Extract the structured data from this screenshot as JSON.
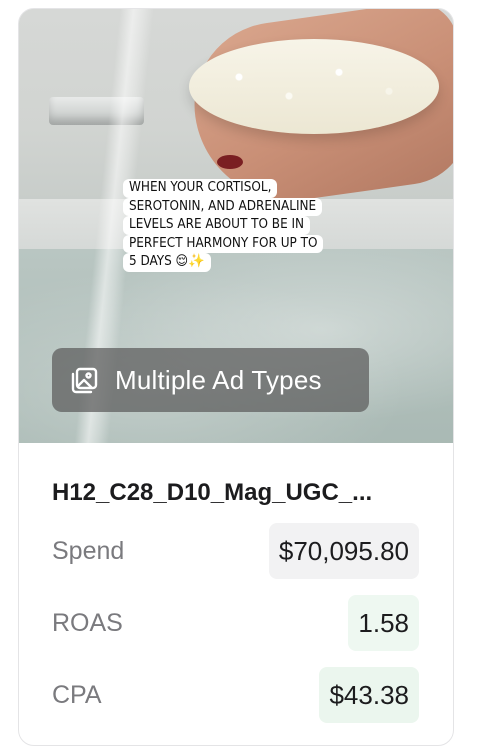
{
  "ad": {
    "caption_lines": [
      "WHEN YOUR CORTISOL,",
      "SEROTONIN, AND ADRENALINE",
      "LEVELS ARE ABOUT TO BE IN",
      "PERFECT HARMONY FOR UP TO",
      "5 DAYS 😌✨"
    ],
    "badge_label": "Multiple Ad Types",
    "badge_icon": "images-icon",
    "title": "H12_C28_D10_Mag_UGC_..."
  },
  "metrics": {
    "spend": {
      "label": "Spend",
      "value": "$70,095.80"
    },
    "roas": {
      "label": "ROAS",
      "value": "1.58"
    },
    "cpa": {
      "label": "CPA",
      "value": "$43.38"
    }
  },
  "colors": {
    "roas_highlight": "#eef8f1",
    "cpa_highlight": "#ebf6ee",
    "spend_highlight": "#f2f2f3"
  }
}
